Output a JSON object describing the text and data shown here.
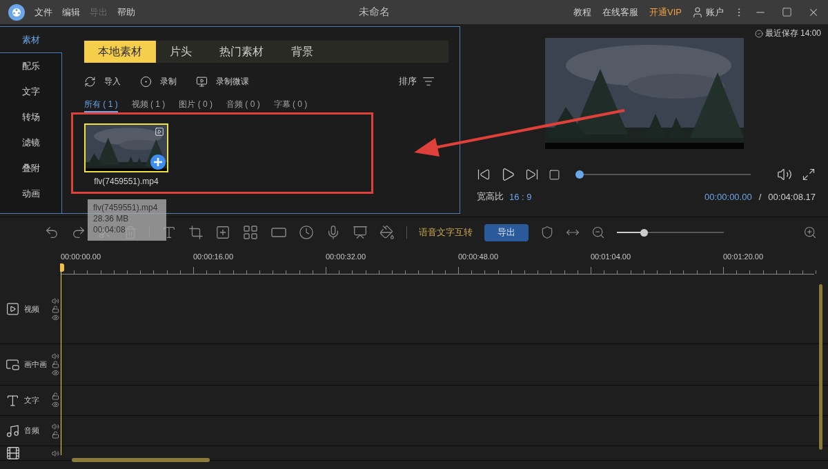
{
  "titlebar": {
    "menu": [
      {
        "label": "文件",
        "disabled": false
      },
      {
        "label": "编辑",
        "disabled": false
      },
      {
        "label": "导出",
        "disabled": true
      },
      {
        "label": "帮助",
        "disabled": false
      }
    ],
    "title": "未命名",
    "links": [
      {
        "label": "教程",
        "highlight": false
      },
      {
        "label": "在线客服",
        "highlight": false
      },
      {
        "label": "开通VIP",
        "highlight": true
      }
    ],
    "account": "账户"
  },
  "sidebar": [
    {
      "label": "素材",
      "selected": true
    },
    {
      "label": "配乐",
      "selected": false
    },
    {
      "label": "文字",
      "selected": false
    },
    {
      "label": "转场",
      "selected": false
    },
    {
      "label": "滤镜",
      "selected": false
    },
    {
      "label": "叠附",
      "selected": false
    },
    {
      "label": "动画",
      "selected": false
    }
  ],
  "media_tabs": [
    {
      "label": "本地素材",
      "selected": true
    },
    {
      "label": "片头",
      "selected": false
    },
    {
      "label": "热门素材",
      "selected": false
    },
    {
      "label": "背景",
      "selected": false
    }
  ],
  "actions": [
    {
      "kind": "import",
      "label": "导入"
    },
    {
      "kind": "record",
      "label": "录制"
    },
    {
      "kind": "screen",
      "label": "录制微课"
    }
  ],
  "sort": "排序",
  "filters": [
    {
      "label": "所有 ( 1 )",
      "selected": true
    },
    {
      "label": "视频 ( 1 )",
      "selected": false
    },
    {
      "label": "图片 ( 0 )",
      "selected": false
    },
    {
      "label": "音频 ( 0 )",
      "selected": false
    },
    {
      "label": "字幕 ( 0 )",
      "selected": false
    }
  ],
  "media_items": [
    {
      "name": "flv(7459551).mp4",
      "selected": true
    }
  ],
  "tooltip": [
    "flv(7459551).mp4",
    "28.36 MB",
    "00:04:08"
  ],
  "preview": {
    "saved": "最近保存 14:00",
    "aspect_label": "宽高比",
    "aspect": "16 : 9",
    "current": "00:00:00.00",
    "separator": "/",
    "total": "00:04:08.17",
    "level": 0
  },
  "toolbar": {
    "speech": "语音文字互转",
    "export": "导出",
    "zoom": {
      "level": 0.25
    }
  },
  "ruler": [
    "00:00:00.00",
    "00:00:16.00",
    "00:00:32.00",
    "00:00:48.00",
    "00:01:04.00",
    "00:01:20.00"
  ],
  "tracks": [
    {
      "kind": "video",
      "label": "视频"
    },
    {
      "kind": "pip",
      "label": "画中画"
    },
    {
      "kind": "text",
      "label": "文字"
    },
    {
      "kind": "audio",
      "label": "音频"
    },
    {
      "kind": "other"
    }
  ]
}
